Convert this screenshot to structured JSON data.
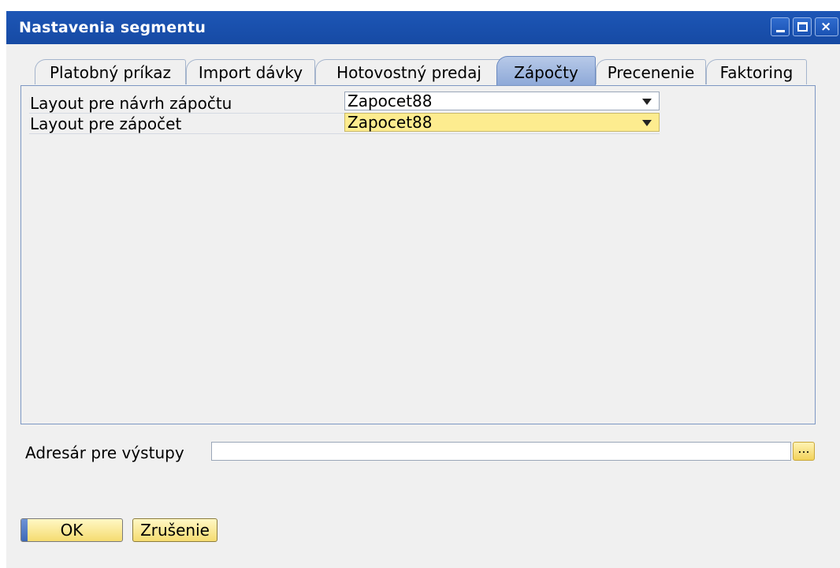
{
  "window": {
    "title": "Nastavenia segmentu",
    "controls": {
      "minimize": "minimize-icon",
      "maximize": "maximize-icon",
      "close": "close-icon",
      "close_glyph": "×"
    }
  },
  "tabs": [
    {
      "label": "Platobný príkaz",
      "active": false
    },
    {
      "label": "Import dávky",
      "active": false
    },
    {
      "label": "Hotovostný predaj",
      "active": false
    },
    {
      "label": "Zápočty",
      "active": true
    },
    {
      "label": "Precenenie",
      "active": false
    },
    {
      "label": "Faktoring",
      "active": false
    }
  ],
  "panel": {
    "rows": [
      {
        "label": "Layout pre návrh zápočtu",
        "value": "Zapocet88",
        "highlighted": false
      },
      {
        "label": "Layout pre zápočet",
        "value": "Zapocet88",
        "highlighted": true
      }
    ]
  },
  "output": {
    "label": "Adresár pre výstupy",
    "value": "",
    "browse_label": "..."
  },
  "buttons": {
    "ok": "OK",
    "cancel": "Zrušenie"
  },
  "colors": {
    "titlebar": "#1d56b6",
    "active_tab": "#9fb6df",
    "highlight_field": "#fdec8f",
    "button_yellow": "#f5dc70"
  }
}
